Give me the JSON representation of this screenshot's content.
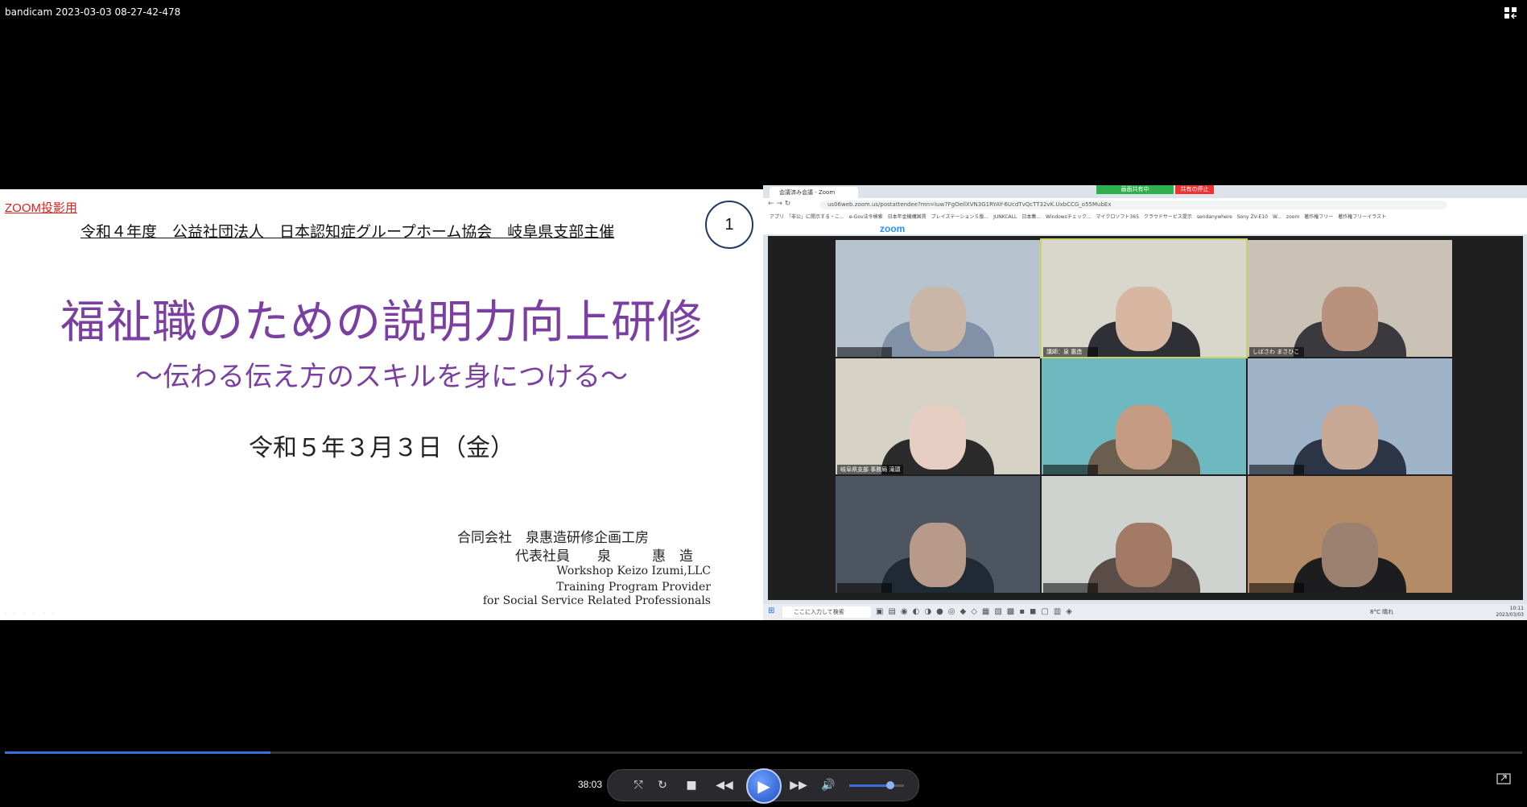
{
  "window": {
    "title": "bandicam 2023-03-03 08-27-42-478"
  },
  "slide": {
    "zoom_label": "ZOOM投影用",
    "organizer": "令和４年度　公益社団法人　日本認知症グループホーム協会　岐阜県支部主催",
    "page_number": "1",
    "title": "福祉職のための説明力向上研修",
    "subtitle": "～伝わる伝え方のスキルを身につける～",
    "date": "令和５年３月３日（金）",
    "company": "合同会社　泉惠造研修企画工房",
    "representative": "代表社員　　泉　　　惠　造",
    "en_line1": "Workshop Keizo Izumi,LLC",
    "en_line2": "Training Program Provider",
    "en_line3": "for Social Service Related Professionals"
  },
  "browser": {
    "tab_title": "会議済み会議 - Zoom",
    "share_status": "画面共有中",
    "stop_share": "共有の停止",
    "url": "us06web.zoom.us/postattendee?mn=Iuw7FgOeIlXVN3G1RYAY-6UcdTvQcTT32vK.UxbCCG_o55MubEx",
    "bookmarks": "アプリ　「非公」に開示する・こ...　e-Gov法令検索　日本年金機構国賃　プレイステーション５版...　JUNKCALL　日本集...　Windowsチェック...　マイクロソフト365　クラウドサービス提示　sendanywhere　Sony ZV-E10　W...　zoom　著作権フリー　著作権フリーイラスト",
    "zoom_logo": "zoom"
  },
  "participants": [
    {
      "name": "",
      "face": "#c9b6a6",
      "bg": "#b7c3cf",
      "body": "#8091a8"
    },
    {
      "name": "講師：泉 惠造",
      "face": "#d7b7a2",
      "bg": "#d9d6cc",
      "body": "#2e3036"
    },
    {
      "name": "しばさわ まさひこ",
      "face": "#b8927c",
      "bg": "#c9c2b5",
      "body": "#3a3a3e"
    },
    {
      "name": "岐阜県支部 事務局 滝頭",
      "face": "#e6cfc2",
      "bg": "#d6d2c6",
      "body": "#2b2b2b"
    },
    {
      "name": "",
      "face": "#c69b84",
      "bg": "#6eb8bf",
      "body": "#6a5e4f"
    },
    {
      "name": "",
      "face": "#c7a995",
      "bg": "#9fb4c9",
      "body": "#2b3546"
    },
    {
      "name": "",
      "face": "#b89a8a",
      "bg": "#4d5660",
      "body": "#202a35"
    },
    {
      "name": "",
      "face": "#a27a66",
      "bg": "#cfd3d0",
      "body": "#5a4d48"
    },
    {
      "name": "",
      "face": "#9c8070",
      "bg": "#b38b66",
      "body": "#1d1d1f"
    }
  ],
  "taskbar": {
    "search_placeholder": "ここに入力して検索",
    "weather": "8°C 晴れ",
    "time": "10:11",
    "date": "2023/03/03"
  },
  "player": {
    "elapsed": "38:03",
    "progress_fraction": 0.175,
    "volume_fraction": 0.75,
    "accent": "#3b6fd8"
  }
}
